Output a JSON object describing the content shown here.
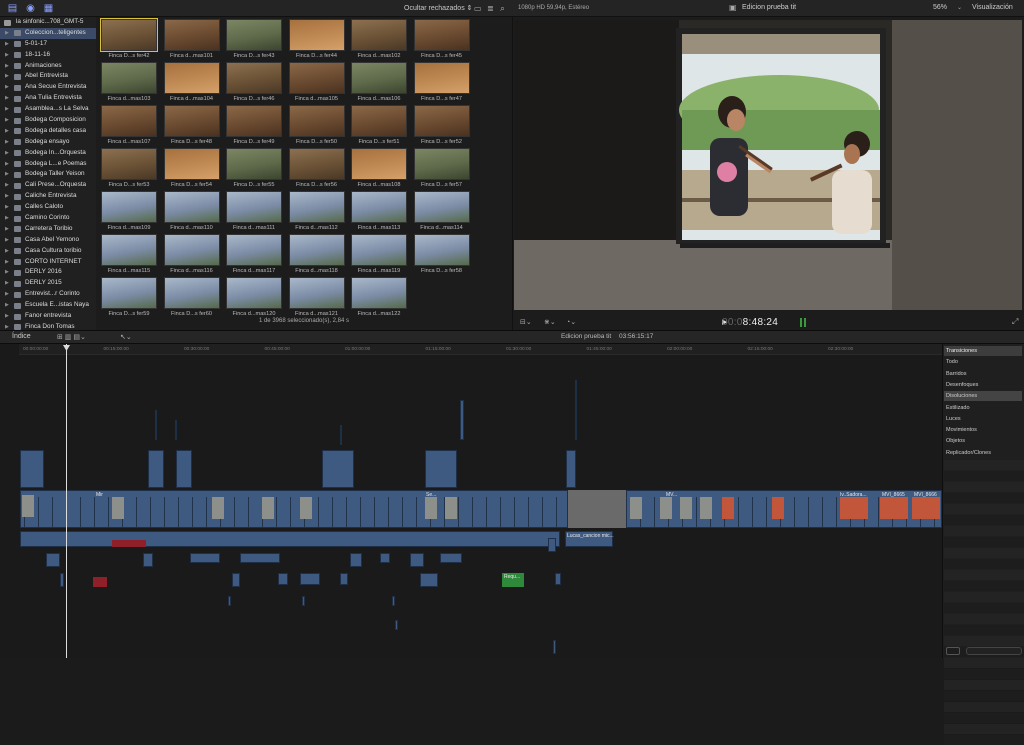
{
  "toolbar": {
    "hide_filter": "Ocultar rechazados ⇕",
    "viewer_format": "1080p HD 59,94p, Estéreo",
    "viewer_title": "Edicion prueba tit",
    "zoom": "56%",
    "visualization": "Visualización"
  },
  "sidebar": {
    "library": "la sinfonic...708_GMT-5",
    "items": [
      "Coleccion...teligentes",
      "5-01-17",
      "18-11-16",
      "Animaciones",
      "Abel Entrevista",
      "Ana Secue Entrevista",
      "Ana Tulia Entrevista",
      "Asamblea...s La Selva",
      "Bodega Composicion",
      "Bodega detalles casa",
      "Bodega ensayo",
      "Bodega In...Orquesta",
      "Bodega L...e Poemas",
      "Bodega Taller Yeison",
      "Cali Prese...Orquesta",
      "Caliche Entrevista",
      "Calles Caloto",
      "Camino Corinto",
      "Carretera Toribio",
      "Casa Abel Yemono",
      "Casa Cultura toribio",
      "CORTO INTERNET",
      "DERLY  2016",
      "DERLY 2015",
      "Entrevist...r Corinto",
      "Escuela E...istas Naya",
      "Fanor entrevista",
      "Finca Don Tomas"
    ]
  },
  "browser": {
    "clips": [
      "Finca D...s fer42",
      "Finca d...mas101",
      "Finca D...s fer43",
      "Finca D...s fer44",
      "Finca d...mas102",
      "Finca D...s fer45",
      "Finca d...mas103",
      "Finca d...mas104",
      "Finca D...s fer46",
      "Finca d...mas105",
      "Finca d...mas106",
      "Finca D...s fer47",
      "Finca d...mas107",
      "Finca D...s fer48",
      "Finca D...s fer49",
      "Finca D...s fer50",
      "Finca D...s fer51",
      "Finca D...s fer52",
      "Finca D...s fer53",
      "Finca D...s fer54",
      "Finca D...s fer55",
      "Finca D...s fer56",
      "Finca d...mas108",
      "Finca D...s fer57",
      "Finca d...mas109",
      "Finca d...mas110",
      "Finca d...mas111",
      "Finca d...mas112",
      "Finca d...mas113",
      "Finca d...mas114",
      "Finca d...mas115",
      "Finca d...mas116",
      "Finca d...mas117",
      "Finca d...mas118",
      "Finca d...mas119",
      "Finca D...s fer58",
      "Finca D...s fer59",
      "Finca D...s fer60",
      "Finca d...mas120",
      "Finca d...mas121",
      "Finca d...mas122"
    ],
    "status": "1 de 3968 seleccionado(s), 2,84 s"
  },
  "viewer": {
    "timecode_dim": "00:0",
    "timecode": "8:48:24"
  },
  "timeline": {
    "index": "Índice",
    "project": "Edicion prueba tit",
    "duration": "03:56:15:17",
    "ruler": [
      "00:00:00:00",
      "00:15:00:00",
      "00:30:00:00",
      "00:45:00:00",
      "01:00:00:00",
      "01:15:00:00",
      "01:30:00:00",
      "01:45:00:00",
      "02:00:00:00",
      "02:15:00:00",
      "02:30:00:00"
    ],
    "clip_labels": {
      "c1": "Mir",
      "c2": "MV...",
      "c3": "Iv..Sadora...",
      "c4": "MVI_8665",
      "c5": "MVI_8666",
      "c6": "Lucas_cancion mic...",
      "c7": "Requ...",
      "c8": "Se..."
    }
  },
  "effects": {
    "items": [
      "Transiciones",
      "Todo",
      "Barridos",
      "Desenfoques",
      "Disoluciones",
      "Estilizado",
      "Luces",
      "Movimientos",
      "Objetos",
      "Replicador/Clones"
    ]
  },
  "colors": {
    "accent": "#8aa0ff",
    "clip_blue": "#3e5a80",
    "clip_red": "#8f1f28",
    "clip_green": "#2e8a3a",
    "selection": "#3b4a66"
  }
}
